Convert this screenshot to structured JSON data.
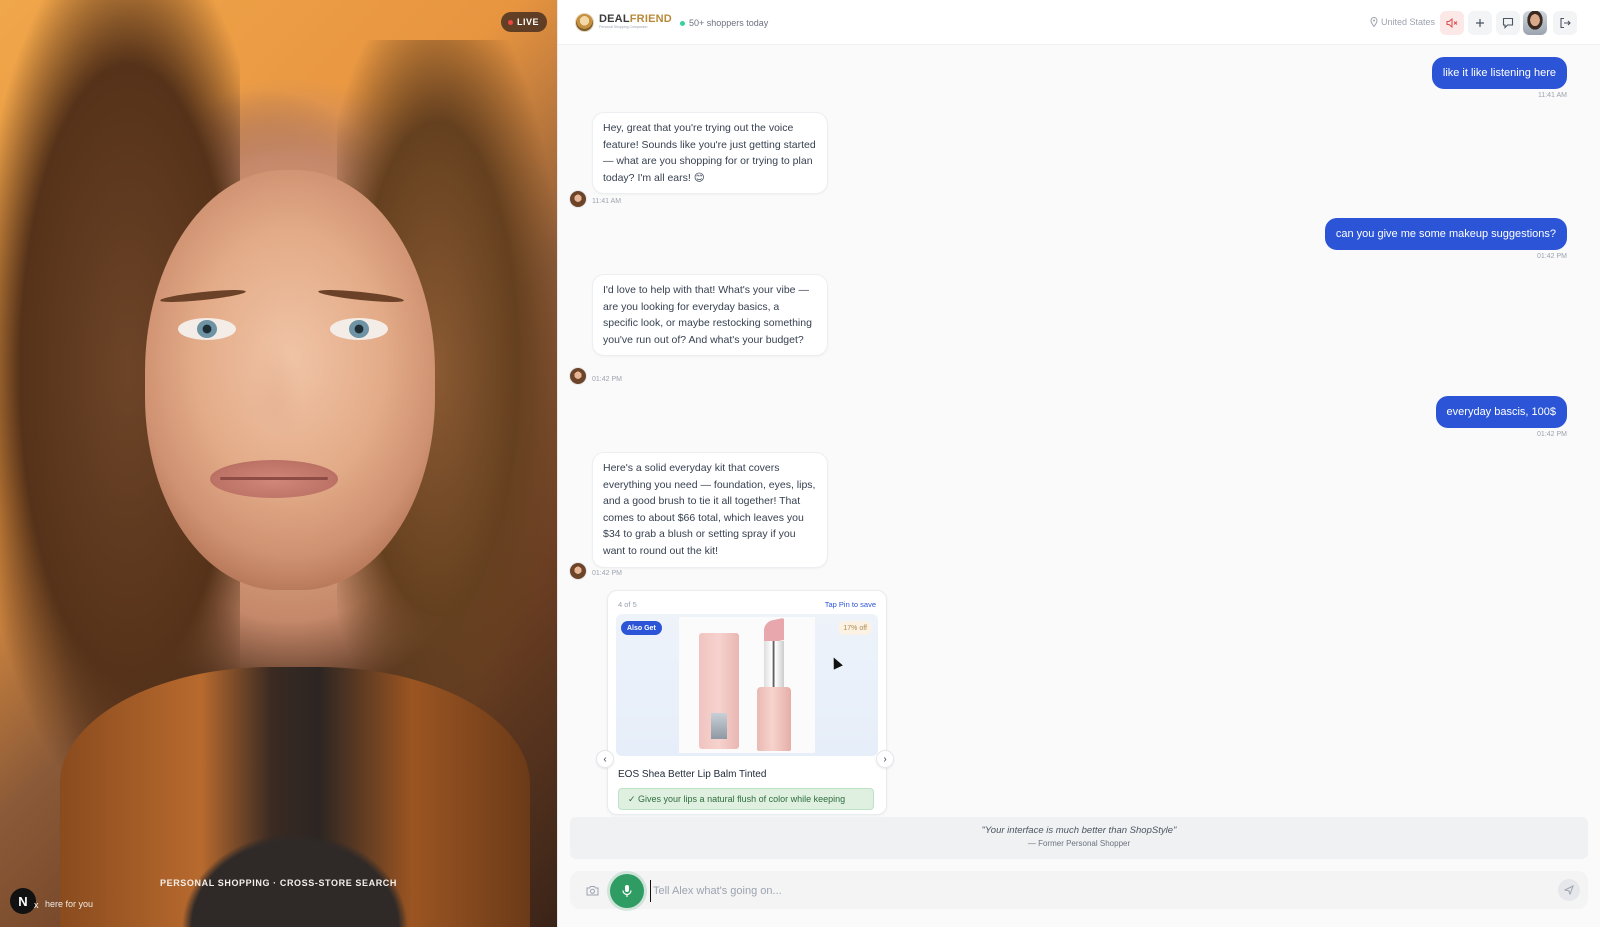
{
  "video": {
    "live_label": "LIVE",
    "caption": "PERSONAL SHOPPING · CROSS-STORE SEARCH",
    "logo_letter": "N",
    "logo_x": "x",
    "status_text": "here for you"
  },
  "header": {
    "brand_part1": "DEAL",
    "brand_part2": "FRIEND",
    "brand_tagline": "Personal Shopping Companion",
    "shoppers": "50+ shoppers today",
    "location": "United States"
  },
  "messages": [
    {
      "role": "user",
      "text": "like it like listening here",
      "time": "11:41 AM"
    },
    {
      "role": "bot",
      "text": "Hey, great that you're trying out the voice feature! Sounds like you're just getting started — what are you shopping for or trying to plan today? I'm all ears! 😊",
      "time": "11:41 AM"
    },
    {
      "role": "user",
      "text": "can you give me some makeup suggestions?",
      "time": "01:42 PM"
    },
    {
      "role": "bot",
      "text": "I'd love to help with that! What's your vibe — are you looking for everyday basics, a specific look, or maybe restocking something you've run out of? And what's your budget?",
      "time": "01:42 PM"
    },
    {
      "role": "user",
      "text": "everyday bascis, 100$",
      "time": "01:42 PM"
    },
    {
      "role": "bot",
      "text": "Here's a solid everyday kit that covers everything you need — foundation, eyes, lips, and a good brush to tie it all together! That comes to about $66 total, which leaves you $34 to grab a blush or setting spray if you want to round out the kit!",
      "time": "01:42 PM"
    }
  ],
  "product_card": {
    "counter": "4 of 5",
    "pin_hint": "Tap Pin to save",
    "badge": "Also Get",
    "discount": "17% off",
    "title": "EOS Shea Better Lip Balm Tinted",
    "benefit": "✓ Gives your lips a natural flush of color while keeping"
  },
  "testimonial": {
    "quote": "\"Your interface is much better than ShopStyle\"",
    "author": "— Former Personal Shopper"
  },
  "composer": {
    "placeholder": "Tell Alex what's going on..."
  },
  "colors": {
    "accent": "#2b55d6",
    "mic": "#2f9d63",
    "live_dot": "#ef4444",
    "brand_gold": "#b8893b"
  },
  "icons": [
    "location-pin-icon",
    "mute-icon",
    "plus-icon",
    "chat-icon",
    "exit-icon",
    "camera-icon",
    "mic-icon",
    "send-icon",
    "chevron-left-icon",
    "chevron-right-icon"
  ]
}
